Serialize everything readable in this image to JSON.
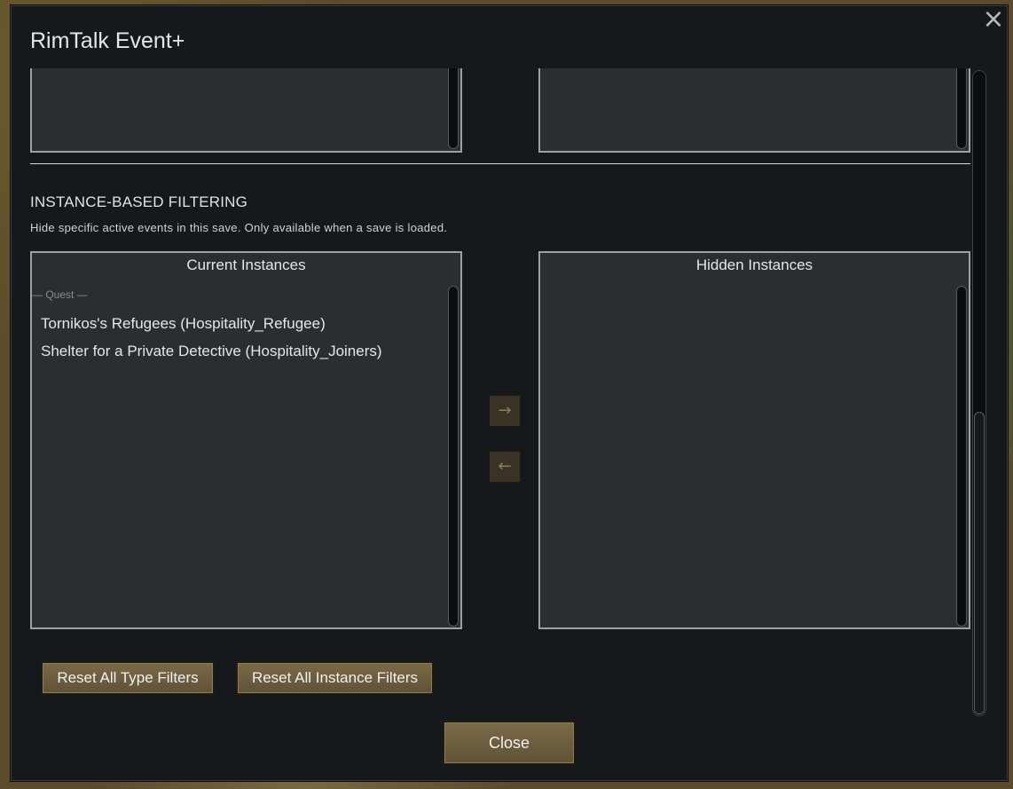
{
  "window": {
    "title": "RimTalk Event+",
    "close_icon": "×"
  },
  "filtering": {
    "heading": "INSTANCE-BASED FILTERING",
    "description": "Hide specific active events in this save. Only available when a save is loaded."
  },
  "current_panel": {
    "header": "Current Instances",
    "group_label": "— Quest —",
    "items": [
      "Tornikos's Refugees (Hospitality_Refugee)",
      "Shelter for a Private Detective (Hospitality_Joiners)"
    ]
  },
  "hidden_panel": {
    "header": "Hidden Instances",
    "items": []
  },
  "transfer": {
    "right_arrow": "→",
    "left_arrow": "←"
  },
  "buttons": {
    "reset_type": "Reset All Type Filters",
    "reset_instance": "Reset All Instance Filters",
    "close": "Close"
  }
}
